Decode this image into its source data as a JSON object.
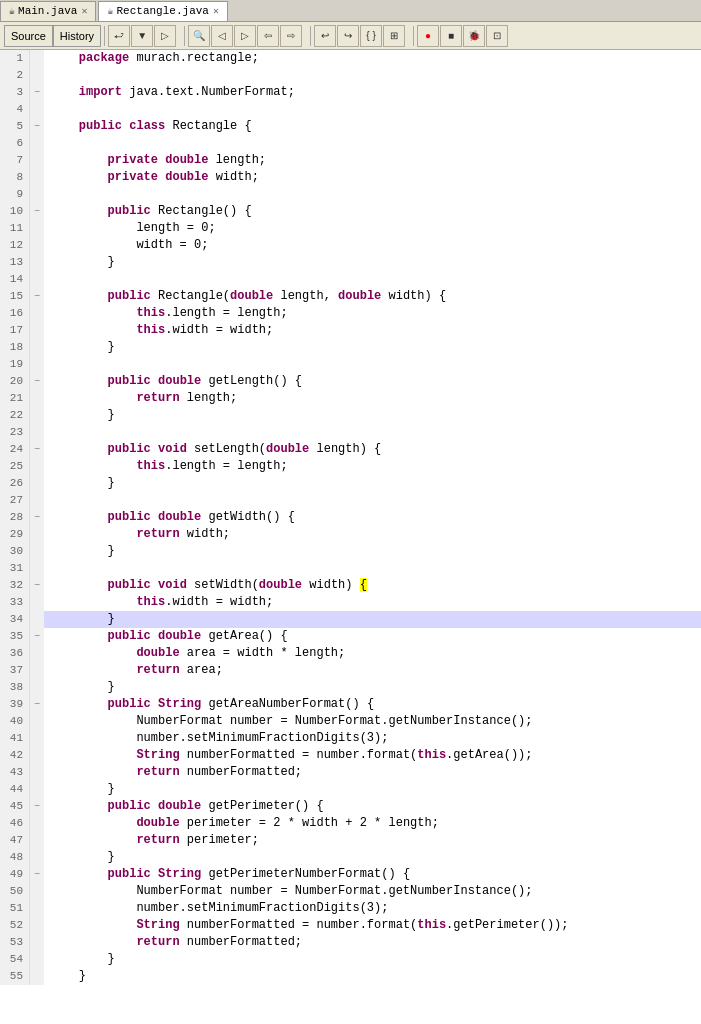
{
  "tabs": [
    {
      "id": "main-java",
      "label": "Main.java",
      "active": false,
      "icon": "J"
    },
    {
      "id": "rectangle-java",
      "label": "Rectangle.java",
      "active": true,
      "icon": "J"
    }
  ],
  "toolbar": {
    "source_label": "Source",
    "history_label": "History"
  },
  "code": {
    "lines": [
      {
        "num": 1,
        "fold": "",
        "content": "    package murach.rectangle;",
        "type": "normal"
      },
      {
        "num": 2,
        "fold": "",
        "content": "",
        "type": "normal"
      },
      {
        "num": 3,
        "fold": "−",
        "content": "    import java.text.NumberFormat;",
        "type": "normal"
      },
      {
        "num": 4,
        "fold": "",
        "content": "",
        "type": "normal"
      },
      {
        "num": 5,
        "fold": "−",
        "content": "    public class Rectangle {",
        "type": "normal"
      },
      {
        "num": 6,
        "fold": "",
        "content": "",
        "type": "normal"
      },
      {
        "num": 7,
        "fold": "",
        "content": "        private double length;",
        "type": "normal"
      },
      {
        "num": 8,
        "fold": "",
        "content": "        private double width;",
        "type": "normal"
      },
      {
        "num": 9,
        "fold": "",
        "content": "",
        "type": "normal"
      },
      {
        "num": 10,
        "fold": "−",
        "content": "        public Rectangle() {",
        "type": "normal"
      },
      {
        "num": 11,
        "fold": "",
        "content": "            length = 0;",
        "type": "normal"
      },
      {
        "num": 12,
        "fold": "",
        "content": "            width = 0;",
        "type": "normal"
      },
      {
        "num": 13,
        "fold": "",
        "content": "        }",
        "type": "normal"
      },
      {
        "num": 14,
        "fold": "",
        "content": "",
        "type": "normal"
      },
      {
        "num": 15,
        "fold": "−",
        "content": "        public Rectangle(double length, double width) {",
        "type": "normal"
      },
      {
        "num": 16,
        "fold": "",
        "content": "            this.length = length;",
        "type": "normal"
      },
      {
        "num": 17,
        "fold": "",
        "content": "            this.width = width;",
        "type": "normal"
      },
      {
        "num": 18,
        "fold": "",
        "content": "        }",
        "type": "normal"
      },
      {
        "num": 19,
        "fold": "",
        "content": "",
        "type": "normal"
      },
      {
        "num": 20,
        "fold": "−",
        "content": "        public double getLength() {",
        "type": "normal"
      },
      {
        "num": 21,
        "fold": "",
        "content": "            return length;",
        "type": "normal"
      },
      {
        "num": 22,
        "fold": "",
        "content": "        }",
        "type": "normal"
      },
      {
        "num": 23,
        "fold": "",
        "content": "",
        "type": "normal"
      },
      {
        "num": 24,
        "fold": "−",
        "content": "        public void setLength(double length) {",
        "type": "normal"
      },
      {
        "num": 25,
        "fold": "",
        "content": "            this.length = length;",
        "type": "normal"
      },
      {
        "num": 26,
        "fold": "",
        "content": "        }",
        "type": "normal"
      },
      {
        "num": 27,
        "fold": "",
        "content": "",
        "type": "normal"
      },
      {
        "num": 28,
        "fold": "−",
        "content": "        public double getWidth() {",
        "type": "normal"
      },
      {
        "num": 29,
        "fold": "",
        "content": "            return width;",
        "type": "normal"
      },
      {
        "num": 30,
        "fold": "",
        "content": "        }",
        "type": "normal"
      },
      {
        "num": 31,
        "fold": "",
        "content": "",
        "type": "normal"
      },
      {
        "num": 32,
        "fold": "−",
        "content": "        public void setWidth(double width) {",
        "type": "normal",
        "highlight_brace": true
      },
      {
        "num": 33,
        "fold": "",
        "content": "            this.width = width;",
        "type": "normal"
      },
      {
        "num": 34,
        "fold": "",
        "content": "        }",
        "type": "current"
      },
      {
        "num": 35,
        "fold": "−",
        "content": "        public double getArea() {",
        "type": "normal"
      },
      {
        "num": 36,
        "fold": "",
        "content": "            double area = width * length;",
        "type": "normal"
      },
      {
        "num": 37,
        "fold": "",
        "content": "            return area;",
        "type": "normal"
      },
      {
        "num": 38,
        "fold": "",
        "content": "        }",
        "type": "normal"
      },
      {
        "num": 39,
        "fold": "−",
        "content": "        public String getAreaNumberFormat() {",
        "type": "normal"
      },
      {
        "num": 40,
        "fold": "",
        "content": "            NumberFormat number = NumberFormat.getNumberInstance();",
        "type": "normal"
      },
      {
        "num": 41,
        "fold": "",
        "content": "            number.setMinimumFractionDigits(3);",
        "type": "normal"
      },
      {
        "num": 42,
        "fold": "",
        "content": "            String numberFormatted = number.format(this.getArea());",
        "type": "normal"
      },
      {
        "num": 43,
        "fold": "",
        "content": "            return numberFormatted;",
        "type": "normal"
      },
      {
        "num": 44,
        "fold": "",
        "content": "        }",
        "type": "normal"
      },
      {
        "num": 45,
        "fold": "−",
        "content": "        public double getPerimeter() {",
        "type": "normal"
      },
      {
        "num": 46,
        "fold": "",
        "content": "            double perimeter = 2 * width + 2 * length;",
        "type": "normal"
      },
      {
        "num": 47,
        "fold": "",
        "content": "            return perimeter;",
        "type": "normal"
      },
      {
        "num": 48,
        "fold": "",
        "content": "        }",
        "type": "normal"
      },
      {
        "num": 49,
        "fold": "−",
        "content": "        public String getPerimeterNumberFormat() {",
        "type": "normal"
      },
      {
        "num": 50,
        "fold": "",
        "content": "            NumberFormat number = NumberFormat.getNumberInstance();",
        "type": "normal"
      },
      {
        "num": 51,
        "fold": "",
        "content": "            number.setMinimumFractionDigits(3);",
        "type": "normal"
      },
      {
        "num": 52,
        "fold": "",
        "content": "            String numberFormatted = number.format(this.getPerimeter());",
        "type": "normal"
      },
      {
        "num": 53,
        "fold": "",
        "content": "            return numberFormatted;",
        "type": "normal"
      },
      {
        "num": 54,
        "fold": "",
        "content": "        }",
        "type": "normal"
      },
      {
        "num": 55,
        "fold": "",
        "content": "    }",
        "type": "normal"
      }
    ]
  }
}
